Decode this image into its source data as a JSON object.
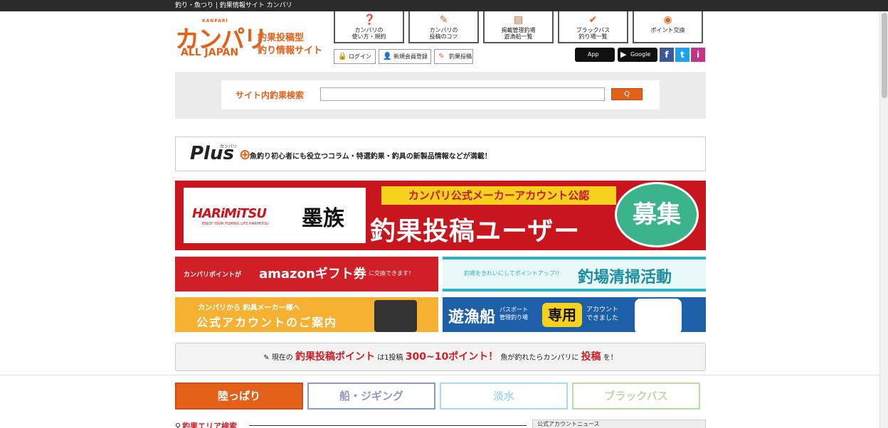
{
  "topbar": {
    "text": "釣り・魚つり | 釣果情報サイト カンパリ"
  },
  "logo": {
    "small": "KANPARI",
    "main": "カンパリ",
    "sub": "ALL JAPAN",
    "tagline1": "釣果投稿型",
    "tagline2": "釣り情報サイト"
  },
  "nav": [
    {
      "label1": "カンパリの",
      "label2": "使い方・規約",
      "icon": "question-icon"
    },
    {
      "label1": "カンパリの",
      "label2": "投稿のコツ",
      "icon": "pencil-icon"
    },
    {
      "label1": "掲載管理釣場",
      "label2": "遊漁船一覧",
      "icon": "document-icon"
    },
    {
      "label1": "ブラックバス",
      "label2": "釣り場一覧",
      "icon": "check-icon"
    },
    {
      "label1": "ポイント交換",
      "label2": "",
      "icon": "coins-icon"
    }
  ],
  "subnav": {
    "login": "ログイン",
    "register": "新規会員登録",
    "post": "釣果投稿"
  },
  "stores": {
    "appstore": "App Store",
    "appstore_small": "Available on the",
    "googleplay": "Google Play",
    "googleplay_small": "で手に入れよう"
  },
  "sns": {
    "facebook": "f",
    "twitter": "t",
    "instagram": "i"
  },
  "search": {
    "label": "サイト内釣果検索",
    "placeholder": "",
    "button": "Q"
  },
  "plus": {
    "logo": "Plus",
    "ruby": "カンパリ",
    "text": "魚釣り初心者にも役立つコラム・特選釣果・釣具の新製品情報などが満載！"
  },
  "big_banner": {
    "brand": "HARiMiTSU",
    "brand_sub": "ENJOY YOUR FISHING LIFE HARIMITSU",
    "brand_kanji": "墨族",
    "ribbon": "カンパリ公式メーカーアカウント公認",
    "title": "釣果投稿ユーザー",
    "circle": "募集"
  },
  "banners": {
    "amazon": {
      "a": "カンパリポイントが",
      "b": "amazonギフト券",
      "c": "に交換できます！"
    },
    "clean": {
      "a": "釣場をきれいにしてポイントアップ!!",
      "b": "釣場清掃活動"
    },
    "maker": {
      "a": "カンパリから 釣具メーカー様へ",
      "b": "公式アカウントのご案内"
    },
    "boat": {
      "a": "遊漁船",
      "b1": "パスポート",
      "b2": "管理釣り場",
      "c": "専用",
      "d1": "アカウント",
      "d2": "できました"
    }
  },
  "points": {
    "prefix": "✎ 現在の",
    "r1": "釣果投稿ポイント",
    "mid": "は1投稿",
    "r2": "300~10ポイント！",
    "mid2": "魚が釣れたらカンパリに",
    "r3": "投稿",
    "suffix": "を！"
  },
  "tabs": [
    "陸っぱり",
    "船・ジギング",
    "淡水",
    "ブラックバス"
  ],
  "area": {
    "title": "釣果エリア検索",
    "news": "公式アカウントニュース"
  }
}
